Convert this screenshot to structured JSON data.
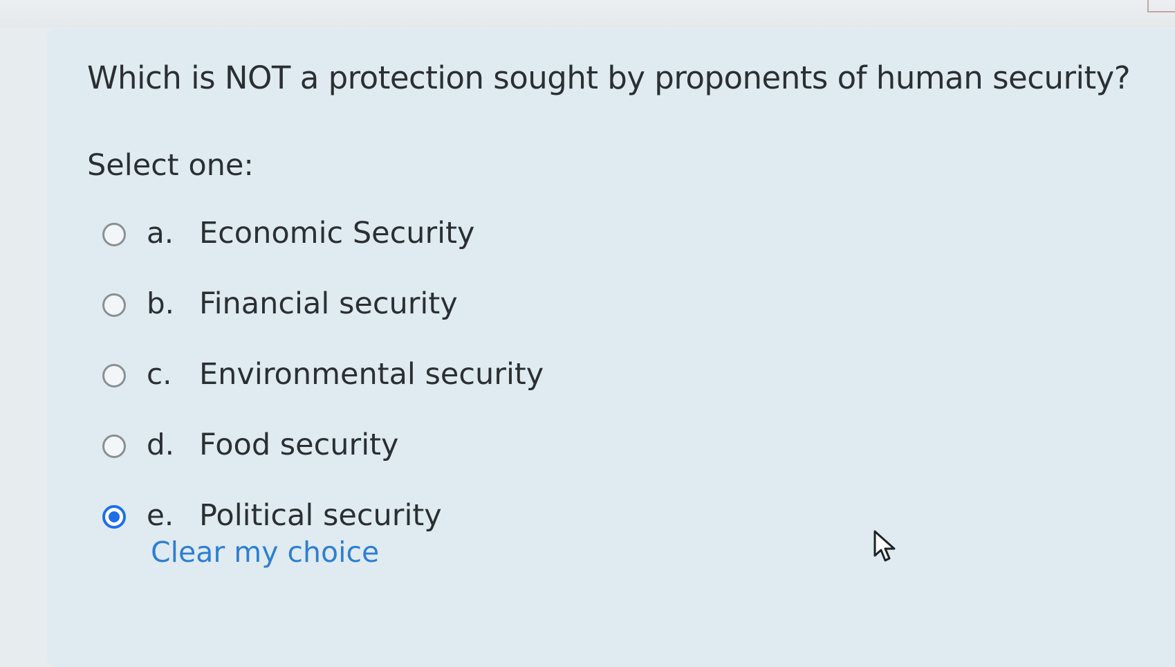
{
  "question": {
    "text": "Which is NOT a protection sought by proponents of human security?",
    "prompt": "Select one:"
  },
  "answers": [
    {
      "letter": "a.",
      "label": "Economic Security",
      "selected": false
    },
    {
      "letter": "b.",
      "label": "Financial security",
      "selected": false
    },
    {
      "letter": "c.",
      "label": "Environmental security",
      "selected": false
    },
    {
      "letter": "d.",
      "label": "Food security",
      "selected": false
    },
    {
      "letter": "e.",
      "label": "Political security",
      "selected": true
    }
  ],
  "clear_choice_label": "Clear my choice",
  "colors": {
    "accent": "#1f6ee8",
    "link": "#2f7fd0",
    "card_background": "#dfebf0",
    "text": "#2b2f33"
  },
  "icons": {
    "cursor": "mouse-pointer-icon",
    "radio": "radio-button-icon"
  }
}
